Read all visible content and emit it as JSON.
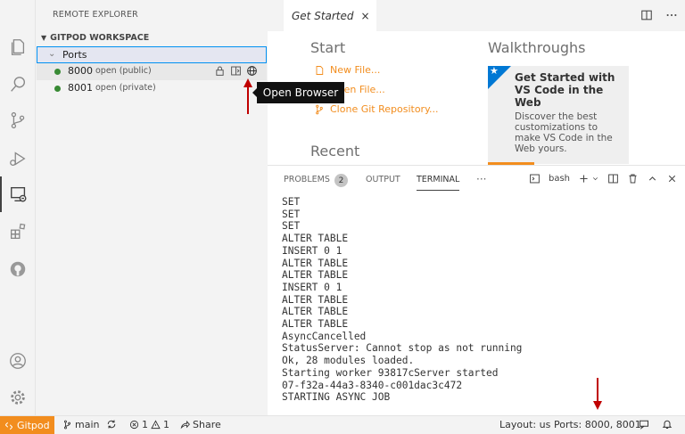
{
  "sidebar": {
    "title": "REMOTE EXPLORER",
    "section": "GITPOD WORKSPACE",
    "group_label": "Ports",
    "ports": [
      {
        "port": "8000",
        "state": "open (public)"
      },
      {
        "port": "8001",
        "state": "open (private)"
      }
    ]
  },
  "tooltip": "Open Browser",
  "editor": {
    "tab_title": "Get Started",
    "tab_close": "×"
  },
  "welcome": {
    "start_heading": "Start",
    "links": [
      "New File...",
      "Open File...",
      "Clone Git Repository..."
    ],
    "recent_heading": "Recent",
    "walkthroughs_heading": "Walkthroughs",
    "card_title": "Get Started with VS Code in the Web",
    "card_desc": "Discover the best customizations to make VS Code in the Web yours."
  },
  "panel": {
    "tabs": [
      "PROBLEMS",
      "OUTPUT",
      "TERMINAL"
    ],
    "problems_count": "2",
    "more": "···",
    "shell": "bash",
    "terminal_lines": [
      "SET",
      "SET",
      "SET",
      "ALTER TABLE",
      "INSERT 0 1",
      "ALTER TABLE",
      "ALTER TABLE",
      "INSERT 0 1",
      "ALTER TABLE",
      "ALTER TABLE",
      "ALTER TABLE",
      "AsyncCancelled",
      "StatusServer: Cannot stop as not running",
      "Ok, 28 modules loaded.",
      "Starting worker 93817cServer started",
      "07-f32a-44a3-8340-c001dac3c472",
      "STARTING ASYNC JOB"
    ]
  },
  "status": {
    "remote": "Gitpod",
    "branch": "main",
    "errors": "1",
    "warnings": "1",
    "share": "Share",
    "layout": "Layout: us",
    "ports": "Ports: 8000, 8001"
  },
  "colors": {
    "accent": "#f28d1e",
    "port_dot": "#388a34",
    "annotation_arrow": "#c00000"
  }
}
